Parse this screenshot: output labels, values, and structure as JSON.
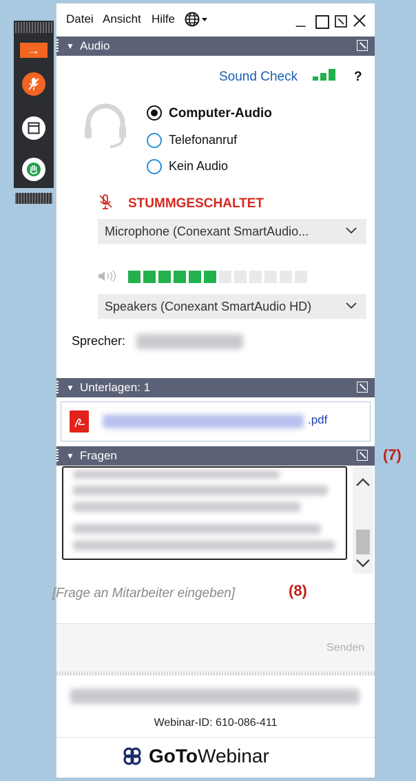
{
  "menu": {
    "file": "Datei",
    "view": "Ansicht",
    "help": "Hilfe"
  },
  "audio": {
    "title": "Audio",
    "sound_check": "Sound Check",
    "help_q": "?",
    "options": [
      {
        "label": "Computer-Audio",
        "selected": true
      },
      {
        "label": "Telefonanruf",
        "selected": false
      },
      {
        "label": "Kein Audio",
        "selected": false
      }
    ],
    "muted_status": "STUMMGESCHALTET",
    "microphone": "Microphone  (Conexant  SmartAudio...",
    "speaker_level": 0.5,
    "speakers": "Speakers (Conexant SmartAudio HD)",
    "speaker_label": "Sprecher:"
  },
  "handouts": {
    "title": "Unterlagen: 1",
    "file_ext": ".pdf"
  },
  "questions": {
    "title": "Fragen",
    "placeholder": "[Frage an Mitarbeiter eingeben]",
    "send": "Senden"
  },
  "annotations": {
    "seven": "(7)",
    "eight": "(8)"
  },
  "footer": {
    "webinar_id": "Webinar-ID: 610-086-411",
    "brand_bold": "GoTo",
    "brand_light": "Webinar"
  },
  "colors": {
    "accent_orange": "#f26522",
    "header_slate": "#5b6176",
    "muted_red": "#d42a1e",
    "level_green": "#22b14c",
    "link_blue": "#1a5fb4"
  }
}
